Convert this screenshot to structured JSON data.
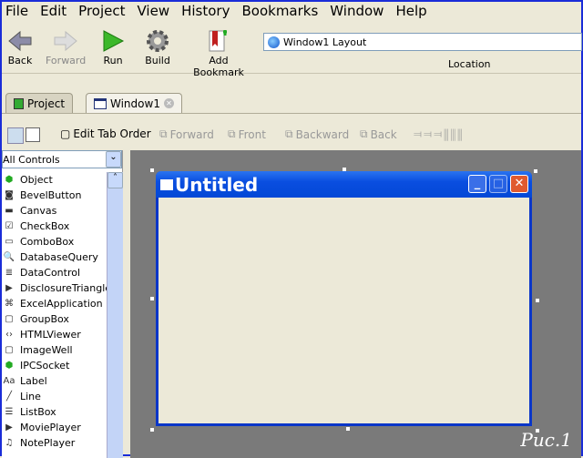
{
  "menu": [
    "File",
    "Edit",
    "Project",
    "View",
    "History",
    "Bookmarks",
    "Window",
    "Help"
  ],
  "toolbar": {
    "back": "Back",
    "forward": "Forward",
    "run": "Run",
    "build": "Build",
    "add_bookmark": "Add Bookmark",
    "location_value": "Window1 Layout",
    "location_label": "Location"
  },
  "tabs": [
    {
      "label": "Project"
    },
    {
      "label": "Window1",
      "active": true
    }
  ],
  "layout_toolbar": {
    "edit_tab_order": "Edit Tab Order",
    "forward": "Forward",
    "front": "Front",
    "backward": "Backward",
    "back": "Back"
  },
  "controls": {
    "filter": "All Controls",
    "items": [
      "Object",
      "BevelButton",
      "Canvas",
      "CheckBox",
      "ComboBox",
      "DatabaseQuery",
      "DataControl",
      "DisclosureTriangle",
      "ExcelApplication",
      "GroupBox",
      "HTMLViewer",
      "ImageWell",
      "IPCSocket",
      "Label",
      "Line",
      "ListBox",
      "MoviePlayer",
      "NotePlayer"
    ]
  },
  "window": {
    "title": "Untitled"
  },
  "caption": "Рис.1"
}
